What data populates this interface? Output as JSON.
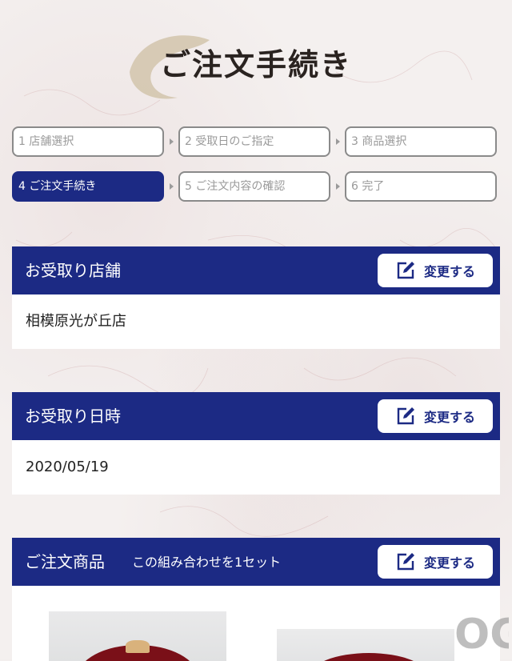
{
  "page": {
    "title": "ご注文手続き"
  },
  "steps": [
    {
      "label": "1 店舗選択",
      "active": false
    },
    {
      "label": "2 受取日のご指定",
      "active": false
    },
    {
      "label": "3 商品選択",
      "active": false
    },
    {
      "label": "4 ご注文手続き",
      "active": true
    },
    {
      "label": "5 ご注文内容の確認",
      "active": false
    },
    {
      "label": "6 完了",
      "active": false
    }
  ],
  "sections": {
    "store": {
      "title": "お受取り店舗",
      "button": "変更する",
      "value": "相模原光が丘店"
    },
    "datetime": {
      "title": "お受取り日時",
      "button": "変更する",
      "value": "2020/05/19"
    },
    "products": {
      "title": "ご注文商品",
      "subtitle": "この組み合わせを1セット",
      "button": "変更する"
    }
  },
  "watermark": {
    "text": "OG"
  },
  "colors": {
    "accent": "#1c2a84",
    "background": "#f4f0ef"
  }
}
